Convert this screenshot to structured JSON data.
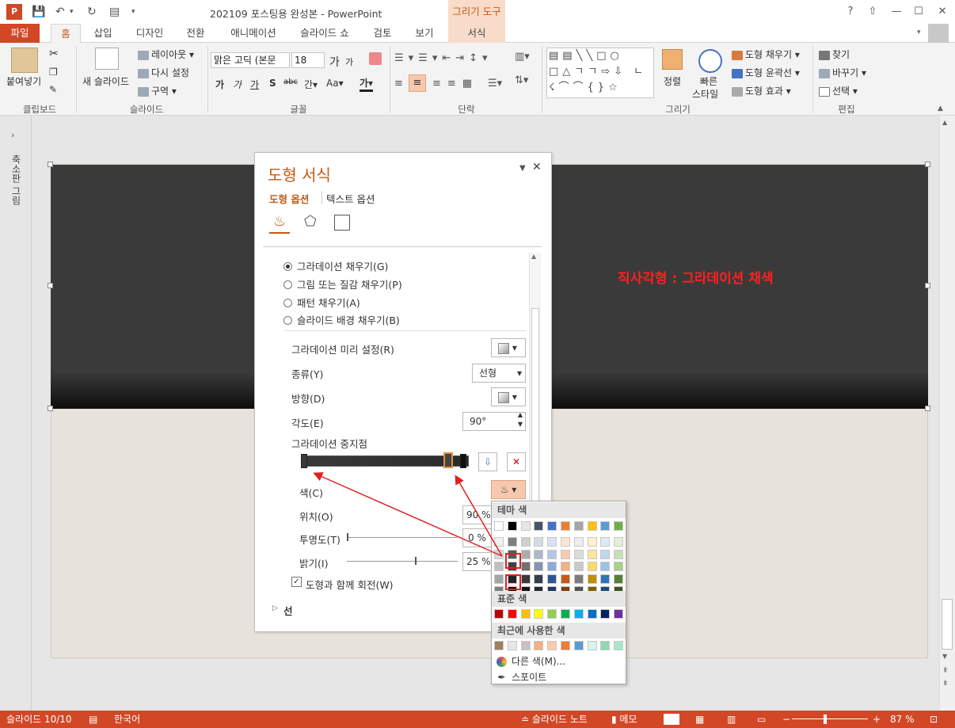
{
  "app": {
    "title": "202109 포스팅용 완성본 - PowerPoint",
    "contextual_tab_group": "그리기 도구",
    "help": "?",
    "window_minimize": "—",
    "window_maximize": "☐",
    "window_close": "✕"
  },
  "tabs": [
    "파일",
    "홈",
    "삽입",
    "디자인",
    "전환",
    "애니메이션",
    "슬라이드 쇼",
    "검토",
    "보기",
    "서식"
  ],
  "ribbon": {
    "clipboard": {
      "paste": "붙여넣기",
      "label": "클립보드"
    },
    "slides": {
      "new_slide": "새 슬라이드",
      "layout": "레이아웃",
      "reset": "다시 설정",
      "section": "구역",
      "label": "슬라이드"
    },
    "font": {
      "font_name": "맑은 고딕 (본문",
      "font_size": "18",
      "bold": "가",
      "italic": "가",
      "underline": "가",
      "shadow": "S",
      "strike": "abc",
      "spacing": "간",
      "case": "Aa",
      "color": "가",
      "grow": "가",
      "shrink": "가",
      "label": "글꼴"
    },
    "paragraph": {
      "label": "단락"
    },
    "drawing": {
      "arrange": "정렬",
      "quick_styles_1": "빠른",
      "quick_styles_2": "스타일",
      "shape_fill": "도형 채우기",
      "shape_outline": "도형 윤곽선",
      "shape_effect": "도형 효과",
      "label": "그리기"
    },
    "editing": {
      "find": "찾기",
      "replace": "바꾸기",
      "select": "선택",
      "label": "편집"
    }
  },
  "left_pane": {
    "label": "축소판 그림"
  },
  "slide": {
    "annotation": "직사각형 : 그라데이션 채색"
  },
  "format_panel": {
    "title": "도형 서식",
    "tab_shape": "도형 옵션",
    "tab_text": "텍스트 옵션",
    "fill_options": [
      {
        "label": "그라데이션 채우기(G)",
        "selected": true
      },
      {
        "label": "그림 또는 질감 채우기(P)",
        "selected": false
      },
      {
        "label": "패턴 채우기(A)",
        "selected": false
      },
      {
        "label": "슬라이드 배경 채우기(B)",
        "selected": false
      }
    ],
    "preset_label": "그라데이션 미리 설정(R)",
    "type_label": "종류(Y)",
    "type_value": "선형",
    "direction_label": "방향(D)",
    "angle_label": "각도(E)",
    "angle_value": "90°",
    "stops_label": "그라데이션 중지점",
    "color_label": "색(C)",
    "position_label": "위치(O)",
    "position_value": "90 %",
    "transparency_label": "투명도(T)",
    "transparency_value": "0 %",
    "brightness_label": "밝기(I)",
    "brightness_value": "25 %",
    "rotate_label": "도형과 함께 회전(W)",
    "rotate_checked": true,
    "line_section": "선"
  },
  "palette": {
    "theme_header": "테마 색",
    "standard_header": "표준 색",
    "recent_header": "최근에 사용한 색",
    "more_colors": "다른 색(M)...",
    "eyedropper": "스포이트",
    "theme_top": [
      "#ffffff",
      "#000000",
      "#e7e6e6",
      "#44546a",
      "#4472c4",
      "#ed7d31",
      "#a5a5a5",
      "#ffc000",
      "#5b9bd5",
      "#70ad47"
    ],
    "theme_shades": [
      [
        "#f2f2f2",
        "#7f7f7f",
        "#d0cece",
        "#d6dce4",
        "#d9e2f3",
        "#fbe5d5",
        "#ededed",
        "#fff2cc",
        "#deeaf6",
        "#e2efd9"
      ],
      [
        "#d8d8d8",
        "#595959",
        "#aeabab",
        "#adb9ca",
        "#b4c6e7",
        "#f7cbac",
        "#dbdbdb",
        "#fee599",
        "#bdd7ee",
        "#c5e0b3"
      ],
      [
        "#bfbfbf",
        "#3f3f3f",
        "#757070",
        "#8496b0",
        "#8eaadb",
        "#f4b183",
        "#c9c9c9",
        "#ffd965",
        "#9cc3e5",
        "#a8d08d"
      ],
      [
        "#a5a5a5",
        "#262626",
        "#3a3838",
        "#323f4f",
        "#2f5496",
        "#c55a11",
        "#7b7b7b",
        "#bf9000",
        "#2e75b5",
        "#538135"
      ],
      [
        "#7f7f7f",
        "#0c0c0c",
        "#171616",
        "#222a35",
        "#1f3864",
        "#833c0b",
        "#525252",
        "#7f6000",
        "#1e4e79",
        "#375623"
      ]
    ],
    "standard": [
      "#c00000",
      "#ff0000",
      "#ffc000",
      "#ffff00",
      "#92d050",
      "#00b050",
      "#00b0f0",
      "#0070c0",
      "#002060",
      "#7030a0"
    ],
    "recent": [
      "#a08060",
      "#e7e6e6",
      "#c9c0c0",
      "#f4b183",
      "#f8cbad",
      "#ed7d31",
      "#5b9bd5",
      "#d5f5ee",
      "#8ed9b0",
      "#a8e6c8"
    ]
  },
  "status": {
    "slide_counter": "슬라이드 10/10",
    "language": "한국어",
    "notes": "슬라이드 노트",
    "comments": "메모",
    "zoom": "87 %"
  }
}
